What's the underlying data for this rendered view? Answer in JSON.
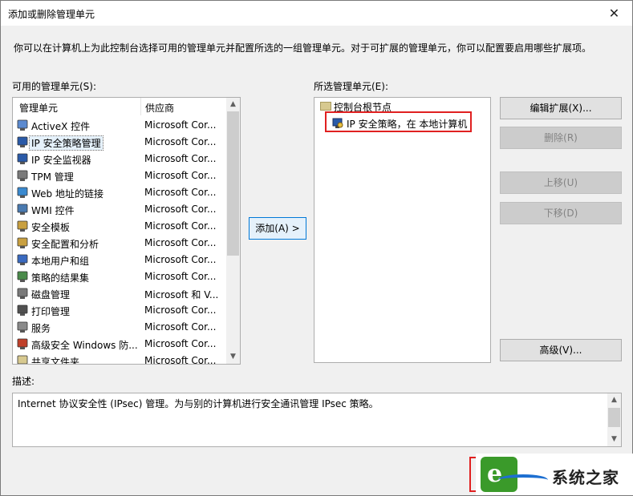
{
  "window": {
    "title": "添加或删除管理单元",
    "close_glyph": "✕",
    "description": "你可以在计算机上为此控制台选择可用的管理单元并配置所选的一组管理单元。对于可扩展的管理单元，你可以配置要启用哪些扩展项。"
  },
  "available": {
    "label": "可用的管理单元(S):",
    "col_name": "管理单元",
    "col_vendor": "供应商",
    "items": [
      {
        "name": "ActiveX 控件",
        "vendor": "Microsoft Cor...",
        "icon": "activex-icon"
      },
      {
        "name": "IP 安全策略管理",
        "vendor": "Microsoft Cor...",
        "icon": "ip-security-policy-icon"
      },
      {
        "name": "IP 安全监视器",
        "vendor": "Microsoft Cor...",
        "icon": "ip-security-monitor-icon"
      },
      {
        "name": "TPM 管理",
        "vendor": "Microsoft Cor...",
        "icon": "tpm-icon"
      },
      {
        "name": "Web 地址的链接",
        "vendor": "Microsoft Cor...",
        "icon": "web-link-icon"
      },
      {
        "name": "WMI 控件",
        "vendor": "Microsoft Cor...",
        "icon": "wmi-icon"
      },
      {
        "name": "安全模板",
        "vendor": "Microsoft Cor...",
        "icon": "security-template-icon"
      },
      {
        "name": "安全配置和分析",
        "vendor": "Microsoft Cor...",
        "icon": "security-config-icon"
      },
      {
        "name": "本地用户和组",
        "vendor": "Microsoft Cor...",
        "icon": "local-users-icon"
      },
      {
        "name": "策略的结果集",
        "vendor": "Microsoft Cor...",
        "icon": "rsop-icon"
      },
      {
        "name": "磁盘管理",
        "vendor": "Microsoft 和 V...",
        "icon": "disk-management-icon"
      },
      {
        "name": "打印管理",
        "vendor": "Microsoft Cor...",
        "icon": "print-management-icon"
      },
      {
        "name": "服务",
        "vendor": "Microsoft Cor...",
        "icon": "services-icon"
      },
      {
        "name": "高级安全 Windows 防...",
        "vendor": "Microsoft Cor...",
        "icon": "firewall-icon"
      },
      {
        "name": "共享文件夹",
        "vendor": "Microsoft Cor...",
        "icon": "shared-folder-icon"
      }
    ],
    "selected_index": 1
  },
  "add_button": "添加(A) >",
  "selected": {
    "label": "所选管理单元(E):",
    "root": "控制台根节点",
    "child": "IP 安全策略，在 本地计算机"
  },
  "buttons": {
    "edit_ext": "编辑扩展(X)...",
    "remove": "删除(R)",
    "move_up": "上移(U)",
    "move_down": "下移(D)",
    "advanced": "高级(V)..."
  },
  "description": {
    "label": "描述:",
    "text": "Internet 协议安全性 (IPsec) 管理。为与别的计算机进行安全通讯管理 IPsec 策略。"
  },
  "watermark": {
    "text": "系统之家"
  },
  "colors": {
    "highlight": "#e02020",
    "accent": "#0078d7"
  }
}
